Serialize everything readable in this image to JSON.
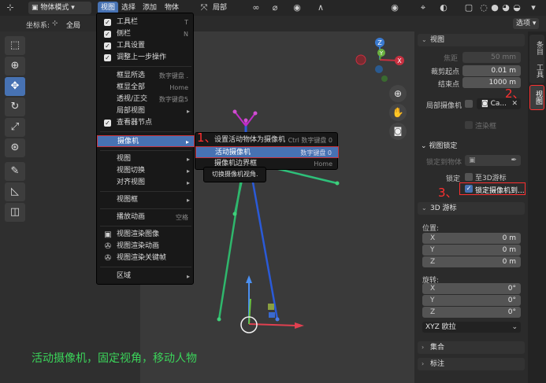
{
  "header": {
    "mode": "物体模式",
    "menus": [
      "视图",
      "选择",
      "添加",
      "物体"
    ],
    "transform": "局部",
    "options": "选项"
  },
  "subheader": {
    "coord_label": "坐标系:",
    "coord_value": "全局"
  },
  "view_menu": {
    "items": [
      {
        "label": "工具栏",
        "shortcut": "T",
        "checked": true
      },
      {
        "label": "侧栏",
        "shortcut": "N",
        "checked": true
      },
      {
        "label": "工具设置",
        "shortcut": "",
        "checked": true
      },
      {
        "label": "调整上一步操作",
        "shortcut": "",
        "checked": true
      },
      {
        "label": "框显所选",
        "shortcut": "数字键盘 ."
      },
      {
        "label": "框显全部",
        "shortcut": "Home"
      },
      {
        "label": "透视/正交",
        "shortcut": "数字键盘5"
      },
      {
        "label": "局部视图",
        "arrow": "▸"
      },
      {
        "label": "查看器节点",
        "checked": true
      },
      {
        "label": "摄像机",
        "arrow": "▸"
      },
      {
        "label": "视图",
        "arrow": "▸"
      },
      {
        "label": "视图切换",
        "arrow": "▸"
      },
      {
        "label": "对齐视图",
        "arrow": "▸"
      },
      {
        "label": "视图框",
        "arrow": "▸"
      },
      {
        "label": "播放动画",
        "shortcut": "空格"
      },
      {
        "label": "视图渲染图像"
      },
      {
        "label": "视图渲染动画"
      },
      {
        "label": "视图渲染关键帧"
      },
      {
        "label": "区域",
        "arrow": "▸"
      }
    ]
  },
  "camera_submenu": {
    "items": [
      {
        "label": "设置活动物体为摄像机",
        "shortcut": "Ctrl 数字键盘 0"
      },
      {
        "label": "活动摄像机",
        "shortcut": "数字键盘 0"
      },
      {
        "label": "摄像机边界框",
        "shortcut": "Home"
      }
    ]
  },
  "tooltip": "切换摄像机视角.",
  "annotations": [
    "1、",
    "2、",
    "3、"
  ],
  "npanel": {
    "view_section": "视图",
    "focal_label": "焦距",
    "focal_value": "50 mm",
    "clip_start_label": "裁剪起点",
    "clip_start_value": "0.01 m",
    "clip_end_label": "结束点",
    "clip_end_value": "1000 m",
    "local_camera_label": "局部摄像机",
    "local_camera_value": "Ca...",
    "render_region_label": "渲染框",
    "view_lock_section": "视图锁定",
    "lock_to_object_label": "锁定到物体",
    "lock_label": "锁定",
    "to_3d_cursor_label": "至3D游标",
    "lock_camera_label": "锁定摄像机到...",
    "cursor_section": "3D 游标",
    "location_label": "位置:",
    "loc_x": {
      "axis": "X",
      "value": "0 m"
    },
    "loc_y": {
      "axis": "Y",
      "value": "0 m"
    },
    "loc_z": {
      "axis": "Z",
      "value": "0 m"
    },
    "rotation_label": "旋转:",
    "rot_x": {
      "axis": "X",
      "value": "0°"
    },
    "rot_y": {
      "axis": "Y",
      "value": "0°"
    },
    "rot_z": {
      "axis": "Z",
      "value": "0°"
    },
    "rotation_mode": "XYZ 欧拉",
    "collection_section": "集合",
    "annotation_section": "标注"
  },
  "tabs": [
    "条目",
    "工具",
    "视图"
  ],
  "gizmo": {
    "x": "X",
    "y": "Y",
    "z": "Z"
  },
  "caption": "活动摄像机，固定视角，移动人物"
}
